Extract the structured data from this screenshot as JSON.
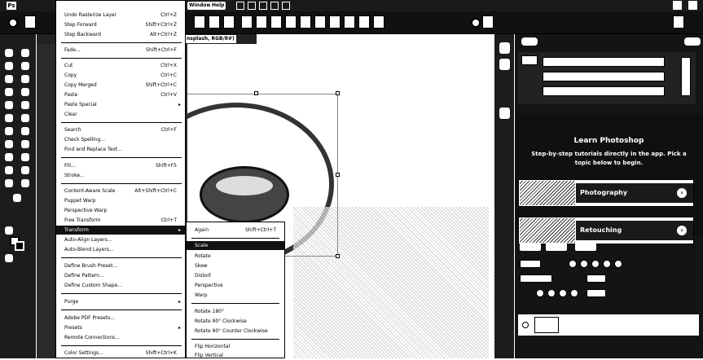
{
  "menubar": {
    "logo": "Ps",
    "items": [
      "Window",
      "Help"
    ]
  },
  "doc_tab": {
    "title": "nsplash, RGB/8#)"
  },
  "edit_menu": {
    "items": [
      {
        "label": "Undo Rasterize Layer",
        "shortcut": "Ctrl+Z"
      },
      {
        "label": "Step Forward",
        "shortcut": "Shift+Ctrl+Z"
      },
      {
        "label": "Step Backward",
        "shortcut": "Alt+Ctrl+Z"
      },
      {
        "label": "Fade...",
        "shortcut": "Shift+Ctrl+F"
      },
      {
        "label": "Cut",
        "shortcut": "Ctrl+X"
      },
      {
        "label": "Copy",
        "shortcut": "Ctrl+C"
      },
      {
        "label": "Copy Merged",
        "shortcut": "Shift+Ctrl+C"
      },
      {
        "label": "Paste",
        "shortcut": "Ctrl+V"
      },
      {
        "label": "Paste Special",
        "shortcut": ""
      },
      {
        "label": "Clear",
        "shortcut": ""
      },
      {
        "label": "Search",
        "shortcut": "Ctrl+F"
      },
      {
        "label": "Check Spelling...",
        "shortcut": ""
      },
      {
        "label": "Find and Replace Text...",
        "shortcut": ""
      },
      {
        "label": "Fill...",
        "shortcut": "Shift+F5"
      },
      {
        "label": "Stroke...",
        "shortcut": ""
      },
      {
        "label": "Content-Aware Scale",
        "shortcut": "Alt+Shift+Ctrl+C"
      },
      {
        "label": "Puppet Warp",
        "shortcut": ""
      },
      {
        "label": "Perspective Warp",
        "shortcut": ""
      },
      {
        "label": "Free Transform",
        "shortcut": "Ctrl+T"
      },
      {
        "label": "Transform",
        "shortcut": ""
      },
      {
        "label": "Auto-Align Layers...",
        "shortcut": ""
      },
      {
        "label": "Auto-Blend Layers...",
        "shortcut": ""
      },
      {
        "label": "Define Brush Preset...",
        "shortcut": ""
      },
      {
        "label": "Define Pattern...",
        "shortcut": ""
      },
      {
        "label": "Define Custom Shape...",
        "shortcut": ""
      },
      {
        "label": "Purge",
        "shortcut": ""
      },
      {
        "label": "Adobe PDF Presets...",
        "shortcut": ""
      },
      {
        "label": "Presets",
        "shortcut": ""
      },
      {
        "label": "Remote Connections...",
        "shortcut": ""
      },
      {
        "label": "Color Settings...",
        "shortcut": "Shift+Ctrl+K"
      }
    ]
  },
  "transform_submenu": {
    "items": [
      {
        "label": "Again",
        "shortcut": "Shift+Ctrl+T"
      },
      {
        "label": "Scale",
        "shortcut": ""
      },
      {
        "label": "Rotate",
        "shortcut": ""
      },
      {
        "label": "Skew",
        "shortcut": ""
      },
      {
        "label": "Distort",
        "shortcut": ""
      },
      {
        "label": "Perspective",
        "shortcut": ""
      },
      {
        "label": "Warp",
        "shortcut": ""
      },
      {
        "label": "Rotate 180°",
        "shortcut": ""
      },
      {
        "label": "Rotate 90° Clockwise",
        "shortcut": ""
      },
      {
        "label": "Rotate 90° Counter Clockwise",
        "shortcut": ""
      },
      {
        "label": "Flip Horizontal",
        "shortcut": ""
      },
      {
        "label": "Flip Vertical",
        "shortcut": ""
      }
    ]
  },
  "learn_panel": {
    "title": "Learn Photoshop",
    "description": "Step-by-step tutorials directly in the app. Pick a topic below to begin.",
    "topics": [
      "Photography",
      "Retouching"
    ]
  }
}
